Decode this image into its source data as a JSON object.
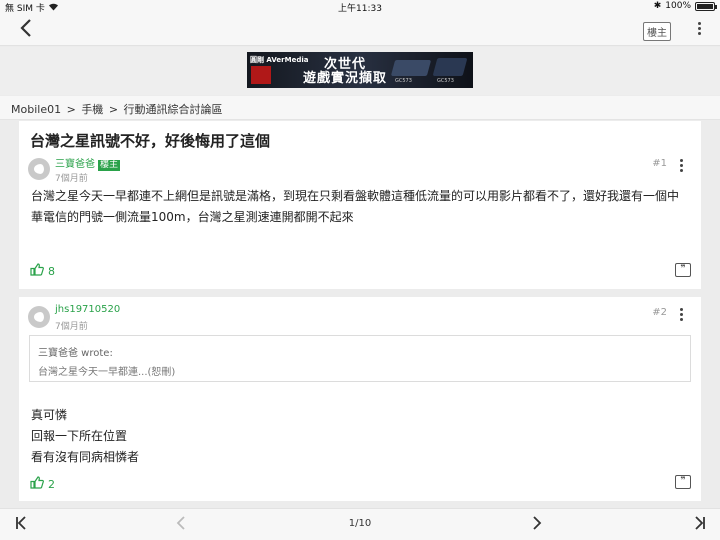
{
  "status_bar": {
    "carrier": "無 SIM 卡",
    "time": "上午11:33",
    "battery": "100%"
  },
  "nav": {
    "op_label": "樓主"
  },
  "ad": {
    "brand": "圓剛 AVerMedia",
    "headline_1": "次世代",
    "headline_2": "遊戲實況擷取",
    "product_1": "GC573",
    "product_2": "GC573"
  },
  "breadcrumb": {
    "items": [
      "Mobile01",
      "手機",
      "行動通訊綜合討論區"
    ],
    "separator": ">"
  },
  "thread": {
    "title": "台灣之星訊號不好，好後悔用了這個"
  },
  "posts": [
    {
      "author": "三寶爸爸",
      "badge": "樓主",
      "time": "7個月前",
      "floor": "#1",
      "content": "台灣之星今天一早都連不上網但是訊號是滿格，到現在只剩看盤軟體這種低流量的可以用影片都看不了，還好我還有一個中華電信的門號一側流量100m，台灣之星測速連開都開不起來",
      "likes": "8"
    },
    {
      "author": "jhs19710520",
      "time": "7個月前",
      "floor": "#2",
      "quote_head": "三寶爸爸 wrote:",
      "quote_body": "台灣之星今天一早都連...(恕刪)",
      "lines": [
        "真可憐",
        "回報一下所在位置",
        "看有沒有同病相憐者"
      ],
      "likes": "2"
    }
  ],
  "pagination": {
    "label": "1/10"
  },
  "colors": {
    "accent": "#2aa24a",
    "background": "#ececec",
    "card": "#ffffff"
  },
  "icons": [
    "back-chevron-icon",
    "more-vertical-icon",
    "thumbs-up-icon",
    "quote-reply-icon",
    "first-page-icon",
    "prev-page-icon",
    "next-page-icon",
    "last-page-icon",
    "wifi-icon",
    "bluetooth-icon",
    "battery-icon"
  ]
}
